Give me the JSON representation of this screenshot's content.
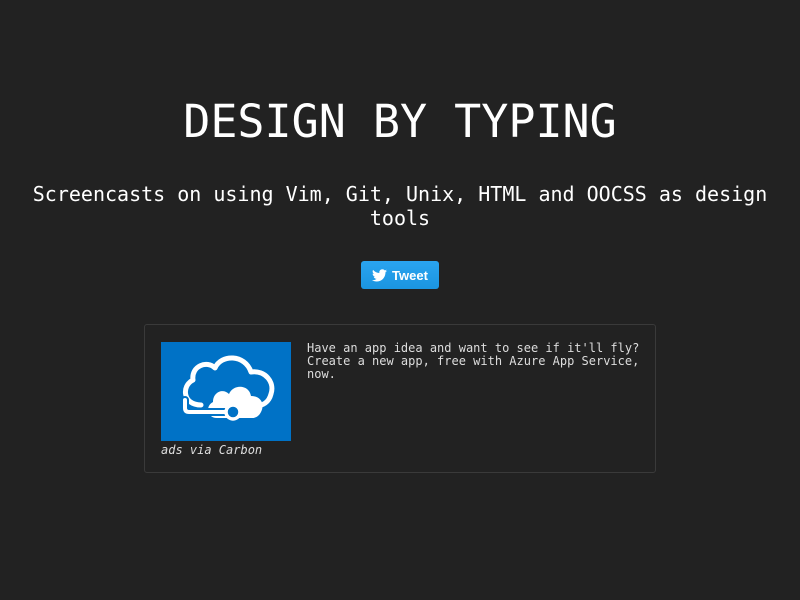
{
  "header": {
    "title": "DESIGN BY TYPING",
    "subtitle": "Screencasts on using Vim, Git, Unix, HTML and OOCSS as design tools"
  },
  "share": {
    "tweet_label": "Tweet",
    "icon": "twitter-bird-icon",
    "color": "#1b95e0"
  },
  "ad": {
    "image_icon": "azure-cloud-icon",
    "image_bg": "#0072c6",
    "text": "Have an app idea and want to see if it'll fly? Create a new app, free with Azure App Service, now.",
    "via": "ads via Carbon"
  },
  "colors": {
    "background": "#222222",
    "text": "#ffffff",
    "ad_border": "#3a3a3a"
  }
}
